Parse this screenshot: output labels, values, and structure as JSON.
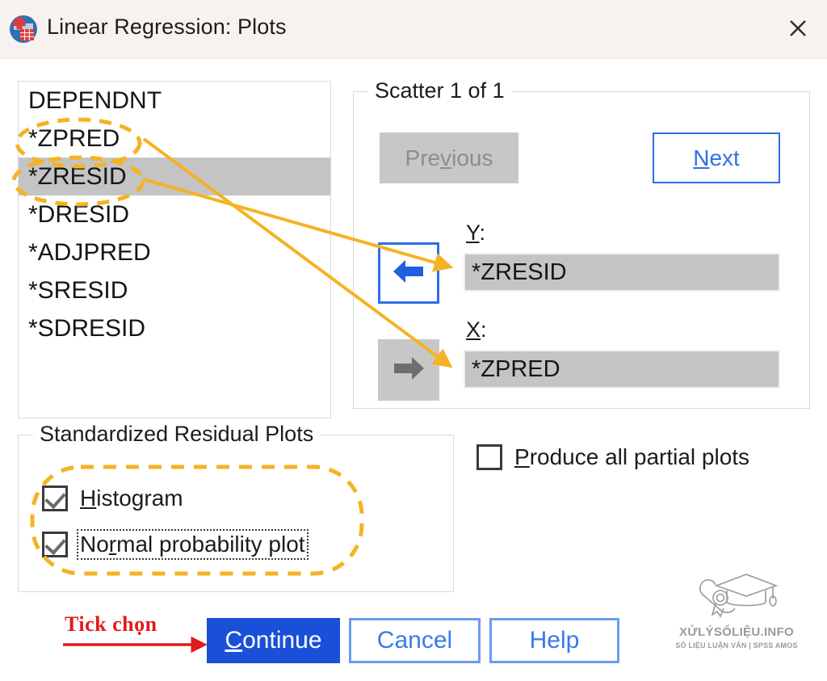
{
  "window": {
    "title": "Linear Regression: Plots",
    "icon": "spss-app-icon",
    "close_label": "✕",
    "titlebar_bg": "#f6f2f0"
  },
  "variable_list": {
    "name": "source-variable-list",
    "items": [
      {
        "label": "DEPENDNT",
        "selected": false
      },
      {
        "label": "*ZPRED",
        "selected": false
      },
      {
        "label": "*ZRESID",
        "selected": true
      },
      {
        "label": "*DRESID",
        "selected": false
      },
      {
        "label": "*ADJPRED",
        "selected": false
      },
      {
        "label": "*SRESID",
        "selected": false
      },
      {
        "label": "*SDRESID",
        "selected": false
      }
    ]
  },
  "scatter": {
    "group_title": "Scatter 1 of 1",
    "previous": {
      "label_before": "Pre",
      "mnemonic": "v",
      "label_after": "ious",
      "enabled": false
    },
    "next": {
      "mnemonic": "N",
      "label_after": "ext",
      "enabled": true
    },
    "y": {
      "label_mnemonic": "Y",
      "label_suffix": ":",
      "value": "*ZRESID",
      "arrow_glyph": "⬅",
      "arrow_enabled": true
    },
    "x": {
      "label_mnemonic": "X",
      "label_suffix": ":",
      "value": "*ZPRED",
      "arrow_glyph": "➡",
      "arrow_enabled": false
    }
  },
  "residual_plots": {
    "group_title": "Standardized Residual Plots",
    "histogram": {
      "mnemonic": "H",
      "label_after": "istogram",
      "checked": true
    },
    "normal_probability_plot": {
      "label_before": "No",
      "mnemonic": "r",
      "label_after": "mal probability plot",
      "checked": true,
      "focused": true
    }
  },
  "partial_plots": {
    "mnemonic": "P",
    "label_after": "roduce all partial plots",
    "checked": false
  },
  "buttons": {
    "continue": {
      "mnemonic": "C",
      "label_after": "ontinue"
    },
    "cancel": "Cancel",
    "help": "Help"
  },
  "annotations": {
    "callout_text": "Tick chọn",
    "callout_color": "#e01b1b",
    "highlight_color": "#f5b323",
    "arrow_color": "#f5b323"
  },
  "watermark": {
    "title": "XỬLÝSỐLIỆU.INFO",
    "subtitle": "SỐ LIỆU LUẬN VĂN | SPSS AMOS",
    "icon": "graduation-cap-diploma-icon"
  },
  "colors": {
    "accent_blue": "#2f6fe8",
    "primary_button": "#1a4fd8",
    "selection_gray": "#c4c4c4",
    "disabled_gray": "#c7c7c7"
  }
}
